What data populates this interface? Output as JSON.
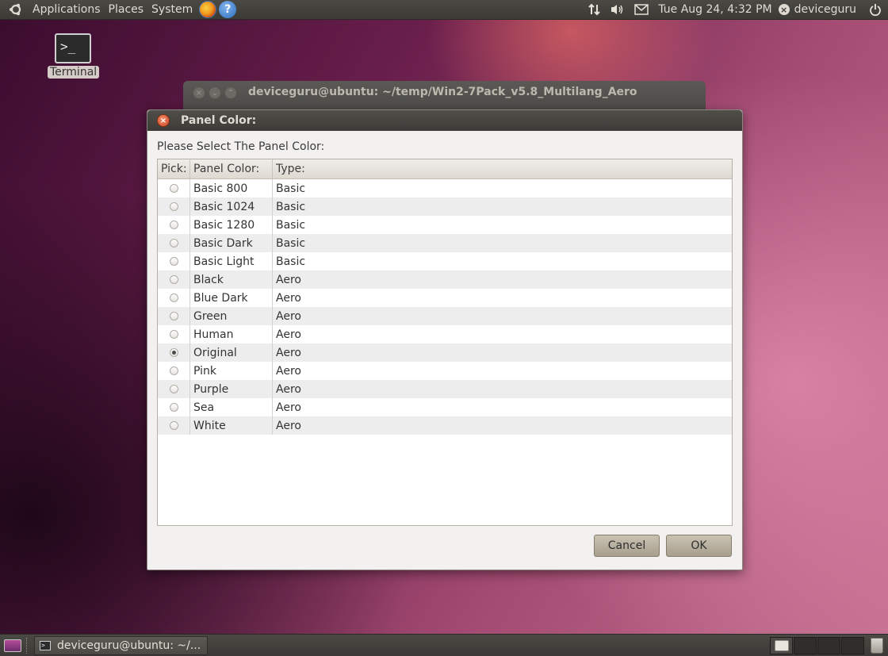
{
  "top_panel": {
    "menus": [
      "Applications",
      "Places",
      "System"
    ],
    "launchers": [
      {
        "icon": "firefox-icon"
      },
      {
        "icon": "help-icon",
        "glyph": "?"
      }
    ],
    "tray": {
      "network_icon": "network-arrows-icon",
      "volume_icon": "speaker-icon",
      "mail_icon": "envelope-icon"
    },
    "clock": "Tue Aug 24,  4:32 PM",
    "user": "deviceguru",
    "power_icon": "power-icon"
  },
  "desktop": {
    "icons": [
      {
        "label": "Terminal",
        "icon": "terminal-icon",
        "glyph": ">_"
      }
    ]
  },
  "background_window": {
    "title": "deviceguru@ubuntu: ~/temp/Win2-7Pack_v5.8_Multilang_Aero"
  },
  "dialog": {
    "title": "Panel Color:",
    "prompt": "Please Select The Panel Color:",
    "columns": [
      "Pick:",
      "Panel Color:",
      "Type:"
    ],
    "rows": [
      {
        "selected": false,
        "color": "Basic 800",
        "type": "Basic"
      },
      {
        "selected": false,
        "color": "Basic 1024",
        "type": "Basic"
      },
      {
        "selected": false,
        "color": "Basic 1280",
        "type": "Basic"
      },
      {
        "selected": false,
        "color": "Basic Dark",
        "type": "Basic"
      },
      {
        "selected": false,
        "color": "Basic Light",
        "type": "Basic"
      },
      {
        "selected": false,
        "color": "Black",
        "type": "Aero"
      },
      {
        "selected": false,
        "color": "Blue Dark",
        "type": "Aero"
      },
      {
        "selected": false,
        "color": "Green",
        "type": "Aero"
      },
      {
        "selected": false,
        "color": "Human",
        "type": "Aero"
      },
      {
        "selected": true,
        "color": "Original",
        "type": "Aero"
      },
      {
        "selected": false,
        "color": "Pink",
        "type": "Aero"
      },
      {
        "selected": false,
        "color": "Purple",
        "type": "Aero"
      },
      {
        "selected": false,
        "color": "Sea",
        "type": "Aero"
      },
      {
        "selected": false,
        "color": "White",
        "type": "Aero"
      }
    ],
    "buttons": {
      "cancel": "Cancel",
      "ok": "OK"
    }
  },
  "bottom_panel": {
    "task": "deviceguru@ubuntu: ~/...",
    "workspaces": 4,
    "active_workspace": 1
  },
  "colors": {
    "panel": "#3c3b37",
    "dialog_bg": "#f2f1f0",
    "button": "#b4ac9c",
    "close_button": "#df5a30"
  }
}
